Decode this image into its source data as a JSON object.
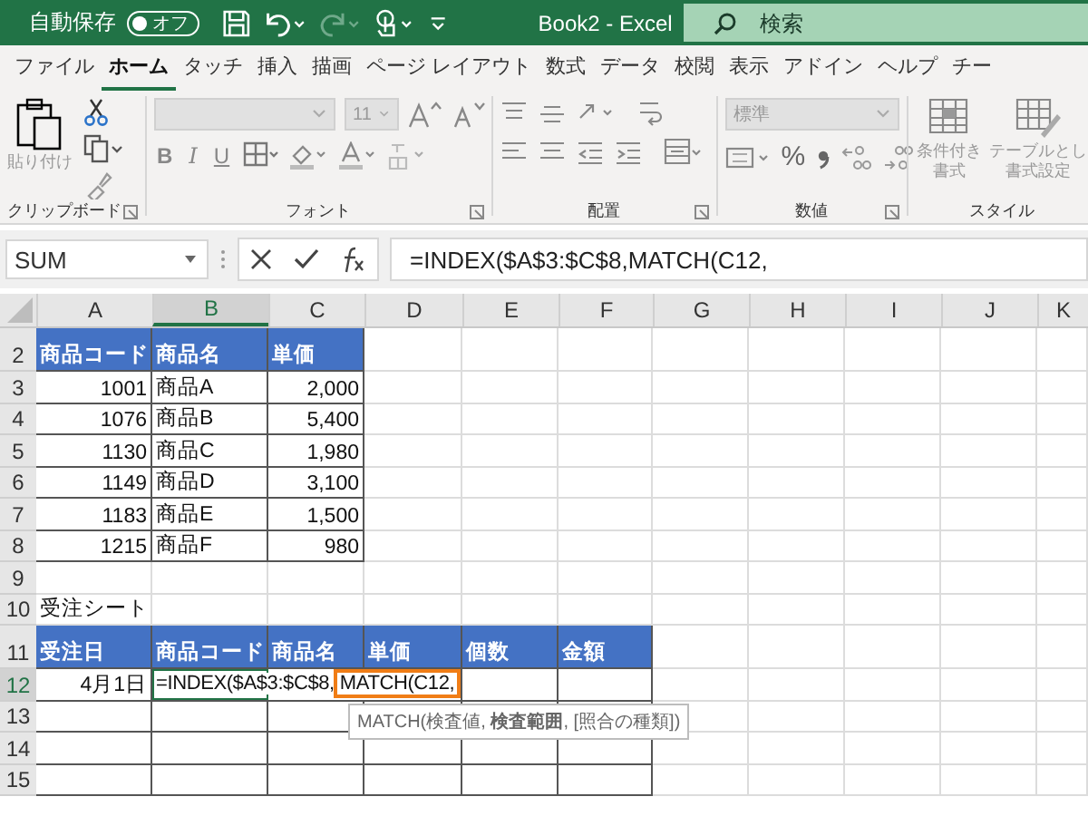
{
  "title_bar": {
    "autosave_label": "自動保存",
    "autosave_toggle": {
      "label": "オフ",
      "on": false
    },
    "quick_access": [
      {
        "kind": "save",
        "disabled": false
      },
      {
        "kind": "undo",
        "disabled": false
      },
      {
        "kind": "redo",
        "disabled": true
      },
      {
        "kind": "touch",
        "disabled": false
      },
      {
        "kind": "customize",
        "disabled": false
      }
    ],
    "document_title": "Book2 - Excel",
    "search": {
      "placeholder": "検索"
    }
  },
  "ribbon_tabs": [
    {
      "label": "ファイル",
      "selected": false
    },
    {
      "label": "ホーム",
      "selected": true
    },
    {
      "label": "タッチ",
      "selected": false
    },
    {
      "label": "挿入",
      "selected": false
    },
    {
      "label": "描画",
      "selected": false
    },
    {
      "label": "ページ レイアウト",
      "selected": false
    },
    {
      "label": "数式",
      "selected": false
    },
    {
      "label": "データ",
      "selected": false
    },
    {
      "label": "校閲",
      "selected": false
    },
    {
      "label": "表示",
      "selected": false
    },
    {
      "label": "アドイン",
      "selected": false
    },
    {
      "label": "ヘルプ",
      "selected": false
    },
    {
      "label": "チー",
      "selected": false
    }
  ],
  "ribbon": {
    "disabled": true,
    "clipboard": {
      "label": "クリップボード",
      "paste": "貼り付け"
    },
    "font": {
      "label": "フォント",
      "font_size": "11",
      "bold": "B",
      "italic": "I",
      "underline": "U"
    },
    "alignment": {
      "label": "配置"
    },
    "number": {
      "label": "数値",
      "format": "標準",
      "percent": "%"
    },
    "styles": {
      "label": "スタイル",
      "buttons": [
        {
          "line1": "条件付き",
          "line2": "書式"
        },
        {
          "line1": "テーブルとし",
          "line2": "書式設定"
        }
      ]
    }
  },
  "formula_bar": {
    "name_box": "SUM",
    "formula": "=INDEX($A$3:$C$8,MATCH(C12,"
  },
  "sheet": {
    "columns": [
      {
        "label": "A",
        "selected": false
      },
      {
        "label": "B",
        "selected": true
      },
      {
        "label": "C",
        "selected": false
      },
      {
        "label": "D",
        "selected": false
      },
      {
        "label": "E",
        "selected": false
      },
      {
        "label": "F",
        "selected": false
      },
      {
        "label": "G",
        "selected": false
      },
      {
        "label": "H",
        "selected": false
      },
      {
        "label": "I",
        "selected": false
      },
      {
        "label": "J",
        "selected": false
      },
      {
        "label": "K",
        "selected": false
      }
    ],
    "rows": [
      {
        "number": "2",
        "selected": false,
        "cells": [
          {
            "kind": "header",
            "text": "商品コード"
          },
          {
            "kind": "header",
            "text": "商品名"
          },
          {
            "kind": "header",
            "text": "単価"
          }
        ]
      },
      {
        "number": "3",
        "selected": false,
        "cells": [
          {
            "kind": "number",
            "text": "1001"
          },
          {
            "kind": "text",
            "text": "商品A"
          },
          {
            "kind": "number",
            "text": "2,000"
          }
        ]
      },
      {
        "number": "4",
        "selected": false,
        "cells": [
          {
            "kind": "number",
            "text": "1076"
          },
          {
            "kind": "text",
            "text": "商品B"
          },
          {
            "kind": "number",
            "text": "5,400"
          }
        ]
      },
      {
        "number": "5",
        "selected": false,
        "cells": [
          {
            "kind": "number",
            "text": "1130"
          },
          {
            "kind": "text",
            "text": "商品C"
          },
          {
            "kind": "number",
            "text": "1,980"
          }
        ]
      },
      {
        "number": "6",
        "selected": false,
        "cells": [
          {
            "kind": "number",
            "text": "1149"
          },
          {
            "kind": "text",
            "text": "商品D"
          },
          {
            "kind": "number",
            "text": "3,100"
          }
        ]
      },
      {
        "number": "7",
        "selected": false,
        "cells": [
          {
            "kind": "number",
            "text": "1183"
          },
          {
            "kind": "text",
            "text": "商品E"
          },
          {
            "kind": "number",
            "text": "1,500"
          }
        ]
      },
      {
        "number": "8",
        "selected": false,
        "cells": [
          {
            "kind": "number",
            "text": "1215"
          },
          {
            "kind": "text",
            "text": "商品F"
          },
          {
            "kind": "number",
            "text": "980"
          }
        ]
      },
      {
        "number": "9",
        "selected": false,
        "cells": []
      },
      {
        "number": "10",
        "selected": false,
        "cells": [
          {
            "kind": "plain",
            "text": "受注シート"
          }
        ]
      },
      {
        "number": "11",
        "selected": false,
        "cells": [
          {
            "kind": "header",
            "text": "受注日"
          },
          {
            "kind": "header",
            "text": "商品コード"
          },
          {
            "kind": "header",
            "text": "商品名"
          },
          {
            "kind": "header",
            "text": "単価"
          },
          {
            "kind": "header",
            "text": "個数"
          },
          {
            "kind": "header",
            "text": "金額"
          }
        ]
      },
      {
        "number": "12",
        "selected": true,
        "cells": [
          {
            "kind": "number",
            "text": "4月1日"
          },
          {
            "kind": "editing",
            "text": "=INDEX($A$3:$C$8,",
            "highlight": "MATCH(C12,",
            "tooltip": "MATCH(検査値, **検査範囲**, [照合の種類])"
          },
          {
            "kind": "blank"
          },
          {
            "kind": "blank"
          }
        ]
      },
      {
        "number": "13",
        "selected": false,
        "cells": [
          {
            "kind": "blank"
          },
          {
            "kind": "blank"
          },
          {
            "kind": "blank"
          },
          {
            "kind": "blank"
          },
          {
            "kind": "blank"
          },
          {
            "kind": "blank"
          }
        ]
      },
      {
        "number": "14",
        "selected": false,
        "cells": [
          {
            "kind": "blank"
          },
          {
            "kind": "blank"
          },
          {
            "kind": "blank"
          },
          {
            "kind": "blank"
          },
          {
            "kind": "blank"
          },
          {
            "kind": "blank"
          }
        ]
      },
      {
        "number": "15",
        "selected": false,
        "cells": [
          {
            "kind": "blank"
          },
          {
            "kind": "blank"
          },
          {
            "kind": "blank"
          },
          {
            "kind": "blank"
          },
          {
            "kind": "blank"
          },
          {
            "kind": "blank"
          }
        ]
      }
    ]
  }
}
